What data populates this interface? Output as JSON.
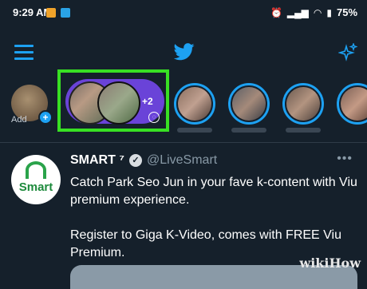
{
  "status_bar": {
    "time": "9:29 AM",
    "icons": [
      "alarm-icon",
      "signal-icon",
      "wifi-icon",
      "battery-icon"
    ],
    "battery": "75"
  },
  "top_bar": {
    "menu_icon": "hamburger-menu-icon",
    "logo_icon": "twitter-bird-icon",
    "sparkle_icon": "top-tweets-sparkle-icon"
  },
  "fleets": {
    "add_label": "Add",
    "group_count": "+2"
  },
  "tweet": {
    "display_name": "SMART",
    "superscript": "⁷",
    "handle": "@LiveSmart",
    "avatar_text": "Smart",
    "paragraphs": [
      "Catch Park Seo Jun in your fave k-content with Viu premium experience.",
      "Register to Giga K-Video, comes with FREE Viu Premium."
    ],
    "more": "•••"
  },
  "watermark": "wikiHow",
  "colors": {
    "background": "#15202b",
    "accent": "#1da1f2",
    "highlight": "#38e023",
    "pill": "#6a43d8"
  }
}
